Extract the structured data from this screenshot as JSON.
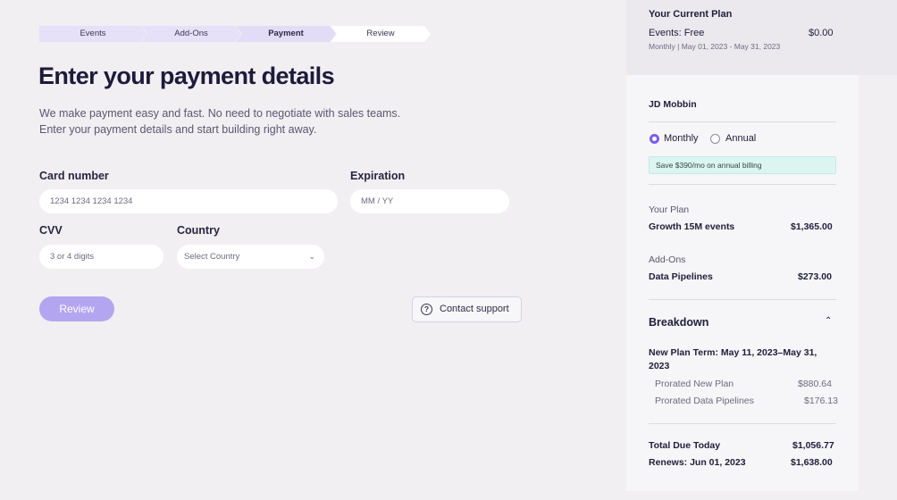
{
  "stepper": {
    "steps": [
      "Events",
      "Add-Ons",
      "Payment",
      "Review"
    ],
    "active": "Payment"
  },
  "page": {
    "title": "Enter your payment details",
    "desc_line1": "We make payment easy and fast. No need to negotiate with sales teams.",
    "desc_line2": "Enter your payment details and start building right away."
  },
  "form": {
    "card_label": "Card number",
    "card_placeholder": "1234 1234 1234 1234",
    "exp_label": "Expiration",
    "exp_placeholder": "MM / YY",
    "cvv_label": "CVV",
    "cvv_placeholder": "3 or 4 digits",
    "country_label": "Country",
    "country_value": "Select Country",
    "review_label": "Review",
    "support_label": "Contact support"
  },
  "current_plan": {
    "heading": "Your Current Plan",
    "name": "Events: Free",
    "price": "$0.00",
    "period": "Monthly | May 01, 2023 - May 31, 2023"
  },
  "summary": {
    "customer": "JD Mobbin",
    "monthly_label": "Monthly",
    "annual_label": "Annual",
    "billing_selected": "Monthly",
    "savings": "Save $390/mo on annual billing",
    "plan_heading": "Your Plan",
    "plan_name": "Growth 15M events",
    "plan_price": "$1,365.00",
    "addons_heading": "Add-Ons",
    "addon_name": "Data Pipelines",
    "addon_price": "$273.00",
    "breakdown_heading": "Breakdown",
    "term_line1": "New Plan Term: May 11, 2023–May 31,",
    "term_line2": "2023",
    "prorated_plan_label": "Prorated New Plan",
    "prorated_plan_value": "$880.64",
    "prorated_pipelines_label": "Prorated Data Pipelines",
    "prorated_pipelines_value": "$176.13",
    "total_label": "Total Due Today",
    "total_value": "$1,056.77",
    "renews_label": "Renews: Jun 01, 2023",
    "renews_value": "$1,638.00"
  },
  "colors": {
    "accent": "#7b5cf0",
    "review_button": "#b4a5f1",
    "savings_bg": "#dcf5f1",
    "background": "#f1eff2"
  },
  "icons": [
    "help-circle-icon",
    "chevron-down-icon",
    "chevron-up-icon"
  ]
}
